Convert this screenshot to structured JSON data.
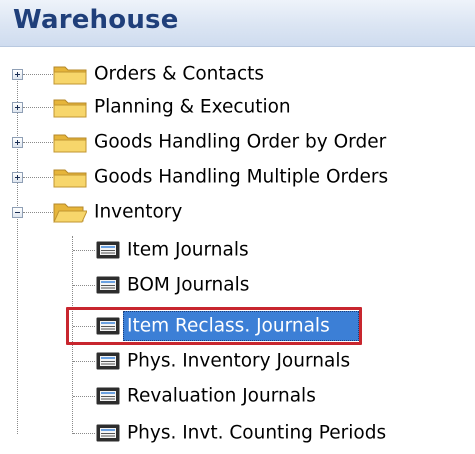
{
  "header": {
    "title": "Warehouse"
  },
  "tree": {
    "folders": [
      {
        "label": "Orders & Contacts"
      },
      {
        "label": "Planning & Execution"
      },
      {
        "label": "Goods Handling Order by Order"
      },
      {
        "label": "Goods Handling Multiple Orders"
      }
    ],
    "open_folder": {
      "label": "Inventory"
    },
    "journals": [
      {
        "label": "Item Journals"
      },
      {
        "label": "BOM Journals"
      },
      {
        "label": "Item Reclass. Journals",
        "selected": true
      },
      {
        "label": "Phys. Inventory Journals"
      },
      {
        "label": "Revaluation Journals"
      },
      {
        "label": "Phys. Invt. Counting Periods"
      }
    ]
  },
  "colors": {
    "header_text": "#1f3f7a",
    "selection": "#3c7fd6",
    "highlight_border": "#c8262e",
    "folder": "#f2c94c"
  }
}
